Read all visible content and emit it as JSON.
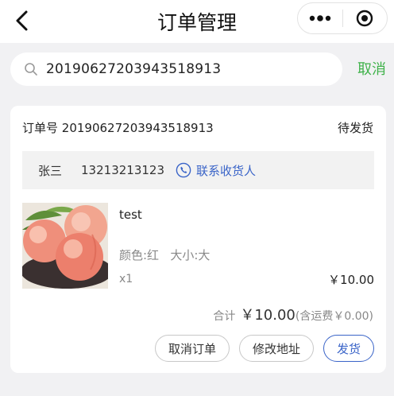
{
  "navbar": {
    "title": "订单管理",
    "back_icon": "chevron-left-icon",
    "more_icon": "more-dots-icon",
    "close_icon": "target-close-icon"
  },
  "search": {
    "value": "20190627203943518913",
    "cancel_label": "取消"
  },
  "order": {
    "number_label": "订单号",
    "number": "20190627203943518913",
    "status": "待发货",
    "receiver_name": "张三",
    "receiver_phone": "13213213123",
    "contact_label": "联系收货人",
    "product": {
      "name": "test",
      "spec": "颜色:红   大小:大",
      "qty": "x1",
      "price": "￥10.00"
    },
    "total_label": "合计",
    "total_amount": "￥10.00",
    "shipping": "(含运费￥0.00)",
    "actions": {
      "cancel_order": "取消订单",
      "edit_address": "修改地址",
      "ship": "发货"
    }
  },
  "colors": {
    "accent_green": "#3fb24a",
    "accent_blue": "#3a64c8",
    "background": "#f1f1f3"
  }
}
